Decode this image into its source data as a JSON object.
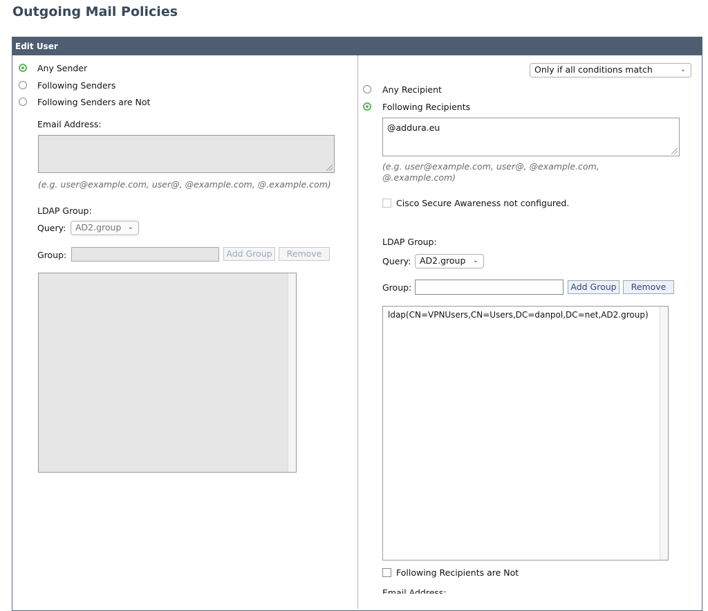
{
  "page": {
    "title": "Outgoing Mail Policies"
  },
  "panel": {
    "header": "Edit User"
  },
  "senders": {
    "options": [
      {
        "label": "Any Sender",
        "selected": true
      },
      {
        "label": "Following Senders",
        "selected": false
      },
      {
        "label": "Following Senders are Not",
        "selected": false
      }
    ],
    "email_label": "Email Address:",
    "email_value": "",
    "email_hint": "(e.g. user@example.com, user@, @example.com, @.example.com)",
    "ldap_label": "LDAP Group:",
    "query_label": "Query:",
    "query_value": "AD2.group",
    "group_label": "Group:",
    "group_value": "",
    "add_group_label": "Add Group",
    "remove_label": "Remove",
    "groups": []
  },
  "recipients": {
    "match_mode": "Only if all conditions match",
    "options": [
      {
        "label": "Any Recipient",
        "selected": false
      },
      {
        "label": "Following Recipients",
        "selected": true
      }
    ],
    "email_value": "@addura.eu",
    "email_hint_line1": "(e.g. user@example.com, user@, @example.com,",
    "email_hint_line2": "@.example.com)",
    "awareness_label": "Cisco Secure Awareness not configured.",
    "ldap_label": "LDAP Group:",
    "query_label": "Query:",
    "query_value": "AD2.group",
    "group_label": "Group:",
    "group_value": "",
    "add_group_label": "Add Group",
    "remove_label": "Remove",
    "groups": [
      "ldap(CN=VPNUsers,CN=Users,DC=danpol,DC=net,AD2.group)"
    ],
    "not_label": "Following Recipients are Not",
    "next_label": "Email Address:"
  },
  "colors": {
    "header_bg": "#4f5d72",
    "title": "#37485a",
    "radio_selected": "#5cb85c",
    "button_text": "#2e4a7a"
  }
}
